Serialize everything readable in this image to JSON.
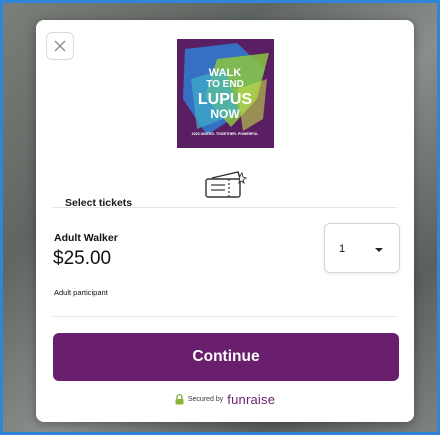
{
  "modal": {
    "close_icon": "close-icon",
    "logo": {
      "line1": "WALK",
      "line2": "TO END",
      "line3": "LUPUS",
      "line4": "NOW",
      "tagline": "2023 UNITED. TOGETHER. POWERFUL"
    },
    "ticket_icon": "ticket-icon",
    "section_label": "Select tickets",
    "ticket": {
      "name": "Adult Walker",
      "price": "$25.00",
      "description": "Adult participant",
      "quantity": "1"
    },
    "continue_label": "Continue",
    "footer": {
      "secured_by": "Secured by",
      "brand": "funraise",
      "lock_icon": "lock-icon"
    }
  },
  "colors": {
    "accent": "#6a1f6e",
    "frame_border": "#2f86d6"
  }
}
